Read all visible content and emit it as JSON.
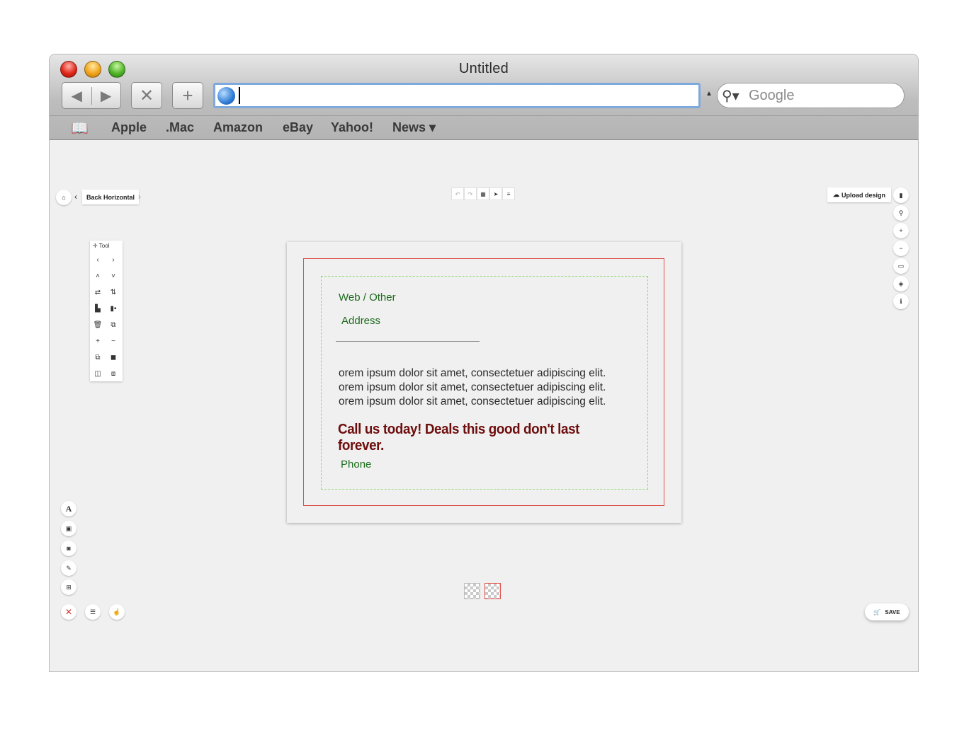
{
  "window": {
    "title": "Untitled"
  },
  "toolbar": {
    "back_glyph": "◀",
    "forward_glyph": "▶",
    "stop_glyph": "✕",
    "add_glyph": "+"
  },
  "address_bar": {
    "value": ""
  },
  "search": {
    "placeholder": "Google"
  },
  "bookmarks": {
    "items": [
      "Apple",
      ".Mac",
      "Amazon",
      "eBay",
      "Yahoo!",
      "News ▾"
    ]
  },
  "breadcrumb": {
    "current": "Back Horizontal"
  },
  "upload_label": "Upload design",
  "tool_panel": {
    "header": "Tool"
  },
  "card": {
    "web": "Web / Other",
    "address": "Address",
    "body_lines": [
      "orem ipsum dolor sit amet, consectetuer adipiscing elit.",
      "orem ipsum dolor sit amet, consectetuer adipiscing elit.",
      "orem ipsum dolor sit amet, consectetuer adipiscing elit."
    ],
    "cta": "Call us today! Deals this good don't last forever.",
    "phone": "Phone",
    "colors": {
      "field_text": "#1d6b1d",
      "cta_text": "#6e0d0d",
      "bleed_border": "#e0504a",
      "safe_border": "#8fd878"
    }
  },
  "save_label": "SAVE",
  "icons": {
    "right_rail": [
      "book-icon",
      "search-icon",
      "zoom-in-icon",
      "zoom-out-icon",
      "preview-icon",
      "cube-icon",
      "info-icon"
    ],
    "left_rail": [
      "text-icon",
      "image-icon",
      "camera-icon",
      "brush-icon",
      "qr-code-icon"
    ],
    "bottom_left": [
      "close-icon",
      "layers-icon",
      "hand-pointer-icon"
    ]
  }
}
